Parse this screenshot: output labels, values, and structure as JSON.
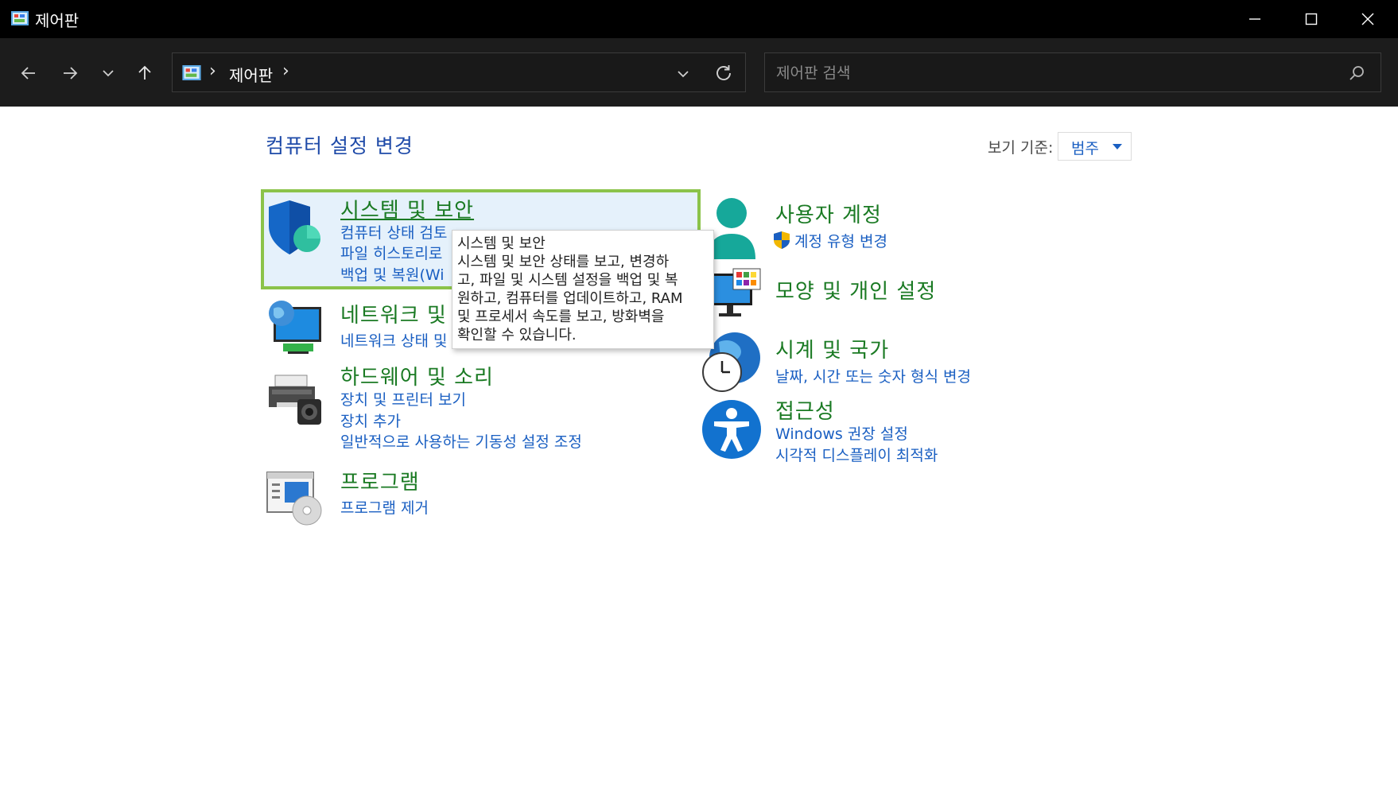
{
  "window": {
    "title": "제어판",
    "minimize_icon": "minimize-icon",
    "maximize_icon": "maximize-icon",
    "close_icon": "close-icon"
  },
  "nav": {
    "back_icon": "arrow-left-icon",
    "forward_icon": "arrow-right-icon",
    "recent_icon": "chevron-down-icon",
    "up_icon": "arrow-up-icon"
  },
  "address": {
    "separator": "›",
    "location": "제어판",
    "refresh_icon": "refresh-icon",
    "dropdown_icon": "chevron-down-icon"
  },
  "search": {
    "placeholder": "제어판 검색",
    "value": "",
    "icon": "search-icon"
  },
  "content": {
    "title": "컴퓨터 설정 변경",
    "view_by_label": "보기 기준:",
    "view_by_value": "범주"
  },
  "categories_left": [
    {
      "title": "시스템 및 보안",
      "icon": "shield-icon",
      "links": [
        "컴퓨터 상태 검토",
        "파일 히스토리로",
        "백업 및 복원(Wi"
      ]
    },
    {
      "title": "네트워크 및",
      "icon": "network-globe-icon",
      "links": [
        "네트워크 상태 및"
      ]
    },
    {
      "title": "하드웨어 및 소리",
      "icon": "printer-speaker-icon",
      "links": [
        "장치 및 프린터 보기",
        "장치 추가",
        "일반적으로 사용하는 기동성 설정 조정"
      ]
    },
    {
      "title": "프로그램",
      "icon": "programs-disc-icon",
      "links": [
        "프로그램 제거"
      ]
    }
  ],
  "categories_right": [
    {
      "title": "사용자 계정",
      "icon": "user-account-icon",
      "links": [
        "계정 유형 변경"
      ],
      "link_icon": "uac-shield-icon"
    },
    {
      "title": "모양 및 개인 설정",
      "icon": "monitor-personalize-icon",
      "links": []
    },
    {
      "title": "시계 및 국가",
      "icon": "clock-globe-icon",
      "links": [
        "날짜, 시간 또는 숫자 형식 변경"
      ]
    },
    {
      "title": "접근성",
      "icon": "accessibility-icon",
      "links": [
        "Windows 권장 설정",
        "시각적 디스플레이 최적화"
      ]
    }
  ],
  "tooltip": {
    "lines": [
      "시스템 및 보안",
      "시스템 및 보안 상태를 보고, 변경하",
      "고, 파일 및 시스템 설정을 백업 및 복",
      "원하고, 컴퓨터를 업데이트하고, RAM",
      "및 프로세서 속도를 보고, 방화벽을",
      "확인할 수 있습니다."
    ]
  },
  "colors": {
    "titlebar_bg": "#000000",
    "navbar_bg": "#1c1c1c",
    "category_title": "#1a7a23",
    "link": "#1a5fc2",
    "page_title": "#1e4aa8",
    "highlight_border": "#8bc34a",
    "highlight_bg": "#e5f1fb"
  }
}
